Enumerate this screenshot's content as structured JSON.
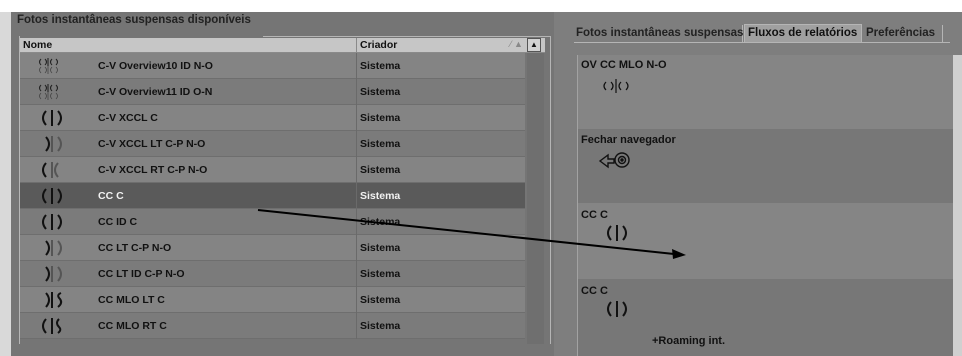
{
  "left_panel": {
    "title": "Fotos instantâneas suspensas disponíveis",
    "columns": {
      "name": "Nome",
      "creator": "Criador"
    },
    "rows": [
      {
        "name": "C-V Overview10 ID N-O",
        "creator": "Sistema",
        "icon": "hanging-protocol-icon"
      },
      {
        "name": "C-V Overview11 ID O-N",
        "creator": "Sistema",
        "icon": "hanging-protocol-icon"
      },
      {
        "name": "C-V XCCL C",
        "creator": "Sistema",
        "icon": "cc-view-icon"
      },
      {
        "name": "C-V XCCL LT C-P N-O",
        "creator": "Sistema",
        "icon": "cc-view-icon"
      },
      {
        "name": "C-V XCCL RT C-P N-O",
        "creator": "Sistema",
        "icon": "cc-view-icon"
      },
      {
        "name": "CC C",
        "creator": "Sistema",
        "icon": "cc-view-icon",
        "selected": true
      },
      {
        "name": "CC ID C",
        "creator": "Sistema",
        "icon": "cc-view-icon"
      },
      {
        "name": "CC LT C-P N-O",
        "creator": "Sistema",
        "icon": "cc-view-icon"
      },
      {
        "name": "CC LT ID C-P N-O",
        "creator": "Sistema",
        "icon": "cc-view-icon"
      },
      {
        "name": "CC MLO LT C",
        "creator": "Sistema",
        "icon": "mlo-view-icon"
      },
      {
        "name": "CC MLO RT C",
        "creator": "Sistema",
        "icon": "mlo-view-icon"
      }
    ]
  },
  "right_panel": {
    "tabs": [
      {
        "label": "Fotos instantâneas suspensas",
        "active": false
      },
      {
        "label": "Fluxos de relatórios",
        "active": true
      },
      {
        "label": "Preferências",
        "active": false
      }
    ],
    "items": [
      {
        "title": "OV CC MLO N-O",
        "icon": "hanging-protocol-icon"
      },
      {
        "title": "Fechar navegador",
        "icon": "close-navigator-icon"
      },
      {
        "title": "CC C",
        "icon": "cc-view-icon"
      },
      {
        "title": "CC C",
        "icon": "cc-view-icon",
        "extra": "+Roaming int."
      }
    ]
  },
  "colors": {
    "background": "#7e7e7e",
    "selected_row": "#5a5a5a",
    "active_tab": "#a0a0a0",
    "arrow": "#000000"
  }
}
